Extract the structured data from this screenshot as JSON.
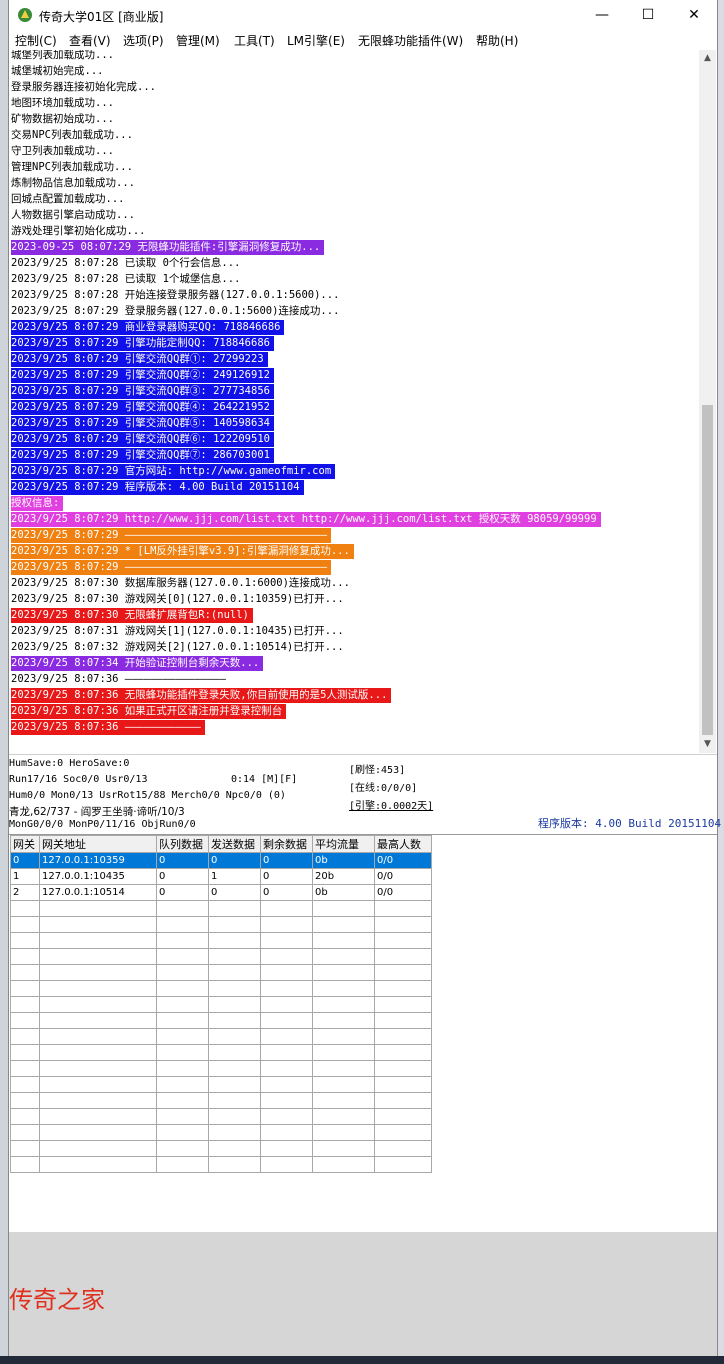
{
  "window": {
    "title": "传奇大学01区 [商业版]",
    "min_glyph": "—",
    "max_glyph": "☐",
    "close_glyph": "✕"
  },
  "menu": [
    "控制(C)",
    "查看(V)",
    "选项(P)",
    "管理(M)",
    "工具(T)",
    "LM引擎(E)",
    "无限蜂功能插件(W)",
    "帮助(H)"
  ],
  "log": {
    "lines": [
      {
        "text": "城堡列表加载成功...",
        "bg": "",
        "fg": "#000000"
      },
      {
        "text": "城堡城初始完成...",
        "bg": "",
        "fg": "#000000"
      },
      {
        "text": "登录服务器连接初始化完成...",
        "bg": "",
        "fg": "#000000"
      },
      {
        "text": "地图环境加载成功...",
        "bg": "",
        "fg": "#000000"
      },
      {
        "text": "矿物数据初始成功...",
        "bg": "",
        "fg": "#000000"
      },
      {
        "text": "交易NPC列表加载成功...",
        "bg": "",
        "fg": "#000000"
      },
      {
        "text": "守卫列表加载成功...",
        "bg": "",
        "fg": "#000000"
      },
      {
        "text": "管理NPC列表加载成功...",
        "bg": "",
        "fg": "#000000"
      },
      {
        "text": "炼制物品信息加载成功...",
        "bg": "",
        "fg": "#000000"
      },
      {
        "text": "回城点配置加载成功...",
        "bg": "",
        "fg": "#000000"
      },
      {
        "text": "人物数据引擎启动成功...",
        "bg": "",
        "fg": "#000000"
      },
      {
        "text": "游戏处理引擎初始化成功...",
        "bg": "",
        "fg": "#000000"
      },
      {
        "text": "2023-09-25 08:07:29 无限蜂功能插件:引擎漏洞修复成功...",
        "bg": "#8a2be2",
        "fg": "#ffffff"
      },
      {
        "text": "2023/9/25 8:07:28 已读取 0个行会信息...",
        "bg": "",
        "fg": "#000000"
      },
      {
        "text": "2023/9/25 8:07:28 已读取 1个城堡信息...",
        "bg": "",
        "fg": "#000000"
      },
      {
        "text": "2023/9/25 8:07:28 开始连接登录服务器(127.0.0.1:5600)...",
        "bg": "",
        "fg": "#000000"
      },
      {
        "text": "2023/9/25 8:07:29 登录服务器(127.0.0.1:5600)连接成功...",
        "bg": "",
        "fg": "#000000"
      },
      {
        "text": "2023/9/25 8:07:29 商业登录器购买QQ: 718846686",
        "bg": "#1010e8",
        "fg": "#ffffff"
      },
      {
        "text": "2023/9/25 8:07:29 引擎功能定制QQ: 718846686",
        "bg": "#1010e8",
        "fg": "#ffffff"
      },
      {
        "text": "2023/9/25 8:07:29 引擎交流QQ群①: 27299223",
        "bg": "#1010e8",
        "fg": "#ffffff"
      },
      {
        "text": "2023/9/25 8:07:29 引擎交流QQ群②: 249126912",
        "bg": "#1010e8",
        "fg": "#ffffff"
      },
      {
        "text": "2023/9/25 8:07:29 引擎交流QQ群③: 277734856",
        "bg": "#1010e8",
        "fg": "#ffffff"
      },
      {
        "text": "2023/9/25 8:07:29 引擎交流QQ群④: 264221952",
        "bg": "#1010e8",
        "fg": "#ffffff"
      },
      {
        "text": "2023/9/25 8:07:29 引擎交流QQ群⑤: 140598634",
        "bg": "#1010e8",
        "fg": "#ffffff"
      },
      {
        "text": "2023/9/25 8:07:29 引擎交流QQ群⑥: 122209510",
        "bg": "#1010e8",
        "fg": "#ffffff"
      },
      {
        "text": "2023/9/25 8:07:29 引擎交流QQ群⑦: 286703001",
        "bg": "#1010e8",
        "fg": "#ffffff"
      },
      {
        "text": "2023/9/25 8:07:29 官方网站: http://www.gameofmir.com",
        "bg": "#1010e8",
        "fg": "#ffffff"
      },
      {
        "text": "2023/9/25 8:07:29 程序版本: 4.00 Build 20151104",
        "bg": "#1010e8",
        "fg": "#ffffff"
      },
      {
        "text": "授权信息:",
        "bg": "#e040e0",
        "fg": "#ffffff"
      },
      {
        "text": "2023/9/25 8:07:29 http://www.jjj.com/list.txt http://www.jjj.com/list.txt 授权天数 98059/99999",
        "bg": "#e040e0",
        "fg": "#ffffff"
      },
      {
        "text": "2023/9/25 8:07:29 ————————————————————————————————",
        "bg": "#f08010",
        "fg": "#ffffff"
      },
      {
        "text": "2023/9/25 8:07:29 * [LM反外挂引擎v3.9]:引擎漏洞修复成功...",
        "bg": "#f08010",
        "fg": "#ffffff"
      },
      {
        "text": "2023/9/25 8:07:29 ————————————————————————————————",
        "bg": "#f08010",
        "fg": "#ffffff"
      },
      {
        "text": "2023/9/25 8:07:30 数据库服务器(127.0.0.1:6000)连接成功...",
        "bg": "",
        "fg": "#000000"
      },
      {
        "text": "2023/9/25 8:07:30 游戏网关[0](127.0.0.1:10359)已打开...",
        "bg": "",
        "fg": "#000000"
      },
      {
        "text": "2023/9/25 8:07:30 无限蜂扩展背包R:(null)",
        "bg": "#e81818",
        "fg": "#ffffff"
      },
      {
        "text": "2023/9/25 8:07:31 游戏网关[1](127.0.0.1:10435)已打开...",
        "bg": "",
        "fg": "#000000"
      },
      {
        "text": "2023/9/25 8:07:32 游戏网关[2](127.0.0.1:10514)已打开...",
        "bg": "",
        "fg": "#000000"
      },
      {
        "text": "2023/9/25 8:07:34 开始验证控制台剩余天数...",
        "bg": "#8a2be2",
        "fg": "#ffffff"
      },
      {
        "text": "2023/9/25 8:07:36 ————————————————",
        "bg": "",
        "fg": "#000000"
      },
      {
        "text": "2023/9/25 8:07:36 无限蜂功能插件登录失败,你目前使用的是5人测试版...",
        "bg": "#e81818",
        "fg": "#ffffff"
      },
      {
        "text": "2023/9/25 8:07:36 如果正式开区请注册并登录控制台",
        "bg": "#e81818",
        "fg": "#ffffff"
      },
      {
        "text": "2023/9/25 8:07:36 ————————————",
        "bg": "#e81818",
        "fg": "#ffffff"
      }
    ]
  },
  "status": {
    "line1": "HumSave:0 HeroSave:0",
    "line2": "Run17/16 Soc0/0 Usr0/13",
    "timer": "0:14 [M][F]",
    "line3": "Hum0/0 Mon0/13 UsrRot15/88 Merch0/0 Npc0/0 (0)",
    "line4": "青龙,62/737 - 阎罗王坐骑·谛听/10/3",
    "line5": "MonG0/0/0 MonP0/11/16 ObjRun0/0",
    "refresh_monster": "[刷怪:453]",
    "online": "[在线:0/0/0]",
    "engine": "[引擎:0.0002天]",
    "version": "程序版本: 4.00 Build 20151104"
  },
  "gateways": {
    "headers": [
      "网关",
      "网关地址",
      "队列数据",
      "发送数据",
      "剩余数据",
      "平均流量",
      "最高人数"
    ],
    "rows": [
      [
        "0",
        "127.0.0.1:10359",
        "0",
        "0",
        "0",
        "0b",
        "0/0"
      ],
      [
        "1",
        "127.0.0.1:10435",
        "0",
        "1",
        "0",
        "20b",
        "0/0"
      ],
      [
        "2",
        "127.0.0.1:10514",
        "0",
        "0",
        "0",
        "0b",
        "0/0"
      ]
    ],
    "selected_row": 0,
    "empty_rows": 17
  },
  "watermark": "传奇之家"
}
